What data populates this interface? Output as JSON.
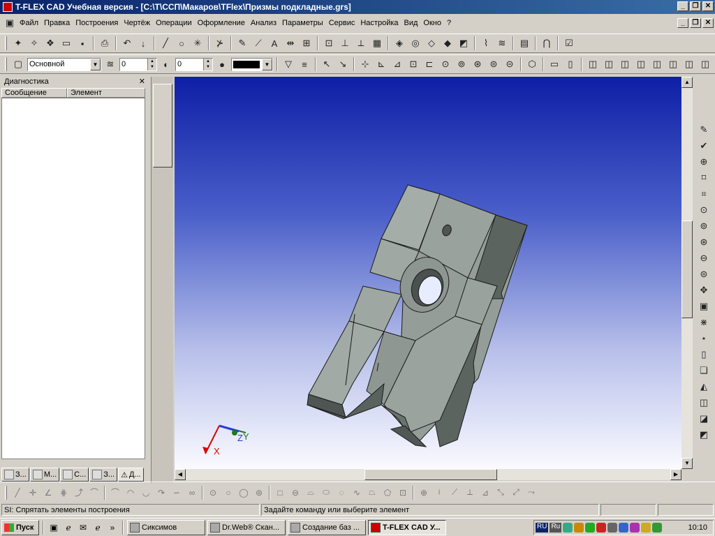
{
  "window": {
    "title": "T-FLEX CAD Учебная версия - [C:\\T\\ССП\\Макаров\\TFlex\\Призмы подкладные.grs]",
    "minimize": "_",
    "restore": "❐",
    "close": "✕"
  },
  "menu": [
    "Файл",
    "Правка",
    "Построения",
    "Чертёж",
    "Операции",
    "Оформление",
    "Анализ",
    "Параметры",
    "Сервис",
    "Настройка",
    "Вид",
    "Окно",
    "?"
  ],
  "toolbar2": {
    "layer": "Основной",
    "value1": "0",
    "value2": "0"
  },
  "panel": {
    "title": "Диагностика",
    "close": "✕",
    "col_message": "Сообщение",
    "col_element": "Элемент",
    "tabs": [
      "З...",
      "М...",
      "С...",
      "З...",
      "Д..."
    ]
  },
  "axes": {
    "x": "X",
    "y": "Y",
    "z": "Z"
  },
  "status": {
    "left": "SI: Спрятать элементы построения",
    "right": "Задайте команду или выберите элемент"
  },
  "taskbar": {
    "start": "Пуск",
    "more": "»",
    "tasks": [
      "Сиксимов",
      "Dr.Web® Скан...",
      "Создание баз ...",
      "T-FLEX CAD У..."
    ],
    "lang1": "RU",
    "lang2": "Ru",
    "clock": "10:10"
  }
}
